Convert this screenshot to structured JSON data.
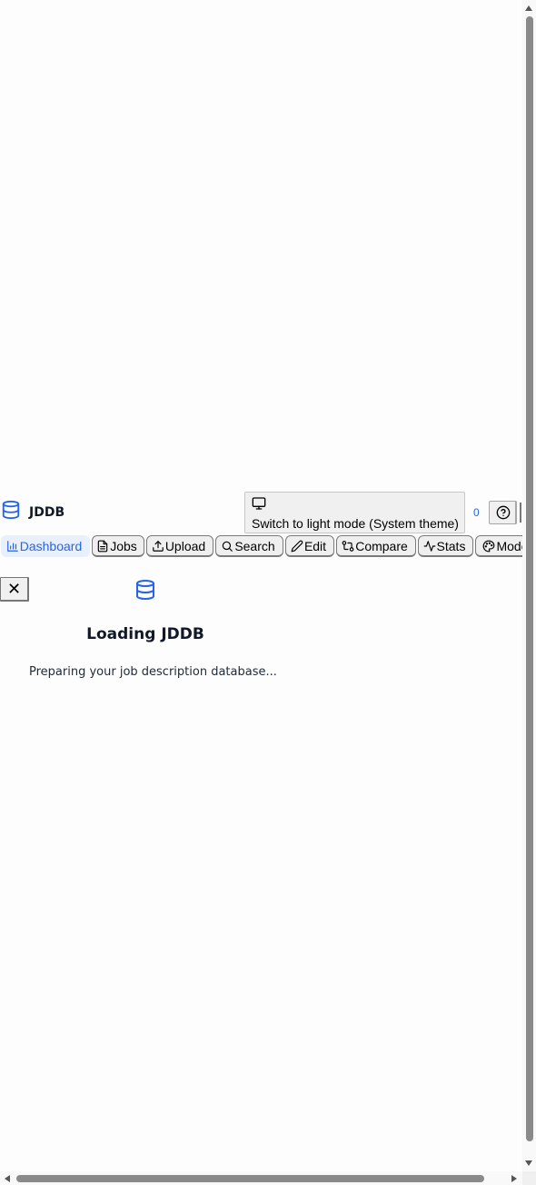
{
  "header": {
    "brand": "JDDB",
    "theme_button_label": "Switch to light mode (System theme)",
    "count": "0"
  },
  "nav": {
    "tabs": [
      {
        "label": "Dashboard",
        "icon": "bar-chart-icon"
      },
      {
        "label": "Jobs",
        "icon": "document-icon"
      },
      {
        "label": "Upload",
        "icon": "upload-icon"
      },
      {
        "label": "Search",
        "icon": "search-icon"
      },
      {
        "label": "Edit",
        "icon": "pencil-icon"
      },
      {
        "label": "Compare",
        "icon": "git-compare-icon"
      },
      {
        "label": "Stats",
        "icon": "activity-icon"
      },
      {
        "label": "Mode",
        "icon": "palette-icon"
      }
    ],
    "active_tab": "Dashboard"
  },
  "loading": {
    "close_label": "✕",
    "title": "Loading JDDB",
    "subtitle": "Preparing your job description database..."
  },
  "colors": {
    "accent": "#2563eb",
    "active_tab_bg": "#e9f0fd"
  }
}
